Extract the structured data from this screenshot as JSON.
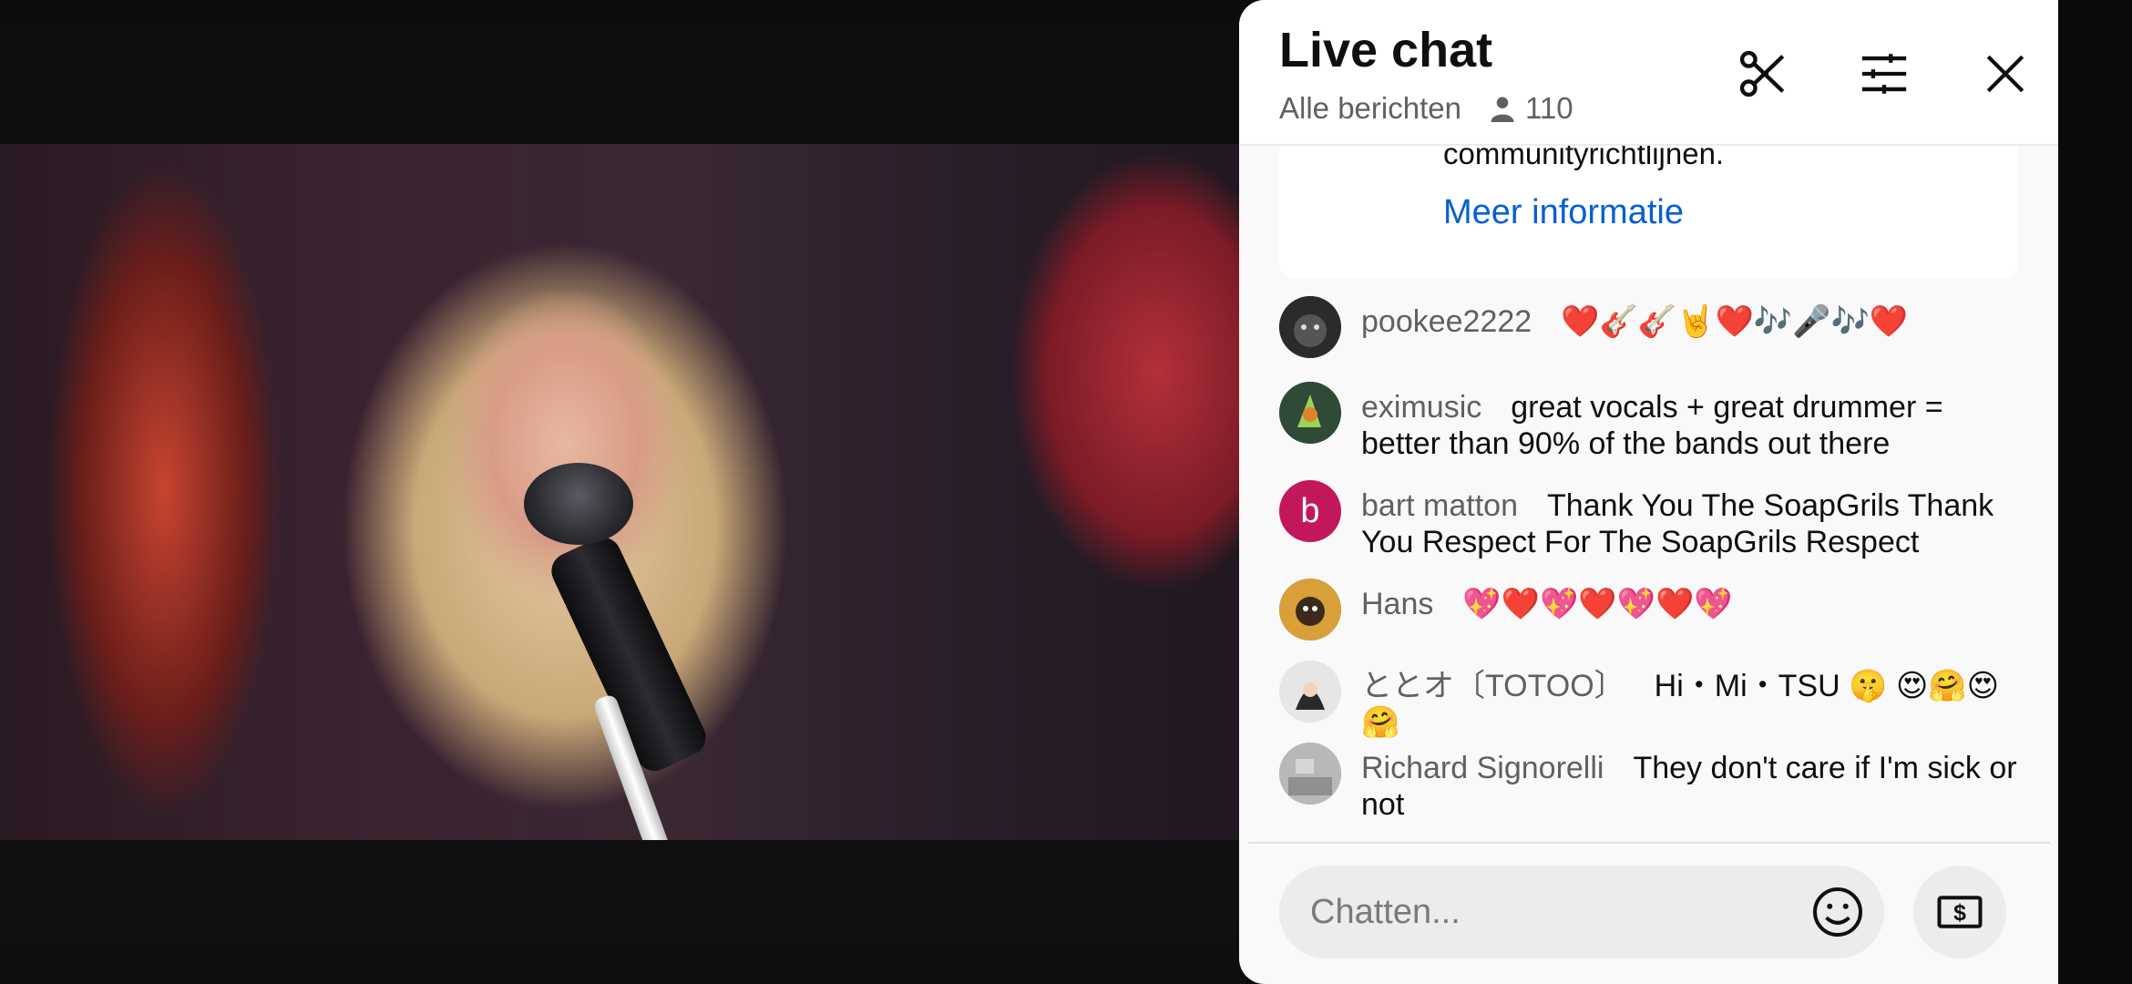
{
  "video": {
    "description_visible": false
  },
  "chat": {
    "title": "Live chat",
    "filter_label": "Alle berichten",
    "viewer_count": "110",
    "notice": {
      "text": "communityrichtlijnen.",
      "link": "Meer informatie"
    },
    "messages": [
      {
        "author": "pookee2222",
        "text": "❤️🎸🎸🤘❤️🎶🎤🎶❤️",
        "avatar_color": "#1a1a1a",
        "avatar_letter": ""
      },
      {
        "author": "eximusic",
        "text": "great vocals + great drummer = better than 90% of the bands out there",
        "avatar_color": "#3b5a3a",
        "avatar_letter": ""
      },
      {
        "author": "bart matton",
        "text": "Thank You The SoapGrils Thank You Respect For The SoapGrils Respect",
        "avatar_color": "#c2185b",
        "avatar_letter": "b"
      },
      {
        "author": "Hans",
        "text": "💖❤️💖❤️💖❤️💖",
        "avatar_color": "#b07a2a",
        "avatar_letter": ""
      },
      {
        "author": "ととオ〔TOTOO〕",
        "text": "Hi・Mi・TSU 🤫 😍🤗😍🤗",
        "avatar_color": "#d9d9d9",
        "avatar_letter": ""
      },
      {
        "author": "Richard Signorelli",
        "text": "They don't care if I'm sick or not",
        "avatar_color": "#9e9e9e",
        "avatar_letter": ""
      }
    ],
    "input_placeholder": "Chatten..."
  },
  "icons": {
    "clip": "scissors-icon",
    "settings": "sliders-icon",
    "close": "close-icon",
    "emoji": "emoji-icon",
    "super_chat": "dollar-icon"
  }
}
